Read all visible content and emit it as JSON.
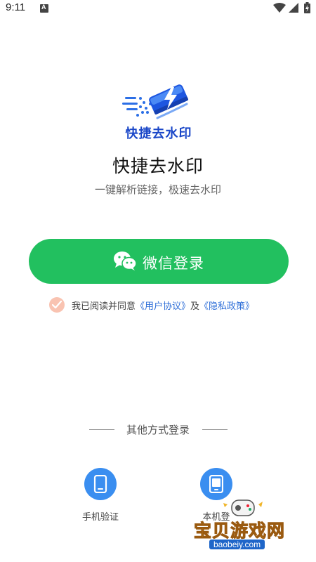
{
  "status_bar": {
    "time": "9:11"
  },
  "logo": {
    "text": "快捷去水印",
    "brand_color": "#1a47c8"
  },
  "app": {
    "title": "快捷去水印",
    "subtitle": "一键解析链接，极速去水印"
  },
  "wechat_login": {
    "label": "微信登录",
    "color": "#22c05f"
  },
  "agreement": {
    "prefix": "我已阅读并同意",
    "user_agreement": "《用户协议》",
    "conjunction": "及",
    "privacy_policy": "《隐私政策》",
    "link_color": "#2f6fd8"
  },
  "other_methods": {
    "heading": "其他方式登录",
    "items": [
      {
        "label": "手机验证",
        "icon": "phone-icon"
      },
      {
        "label": "本机登",
        "icon": "tablet-icon"
      }
    ]
  },
  "watermark": {
    "text": "宝贝游戏网",
    "url": "baobeiy.com"
  }
}
